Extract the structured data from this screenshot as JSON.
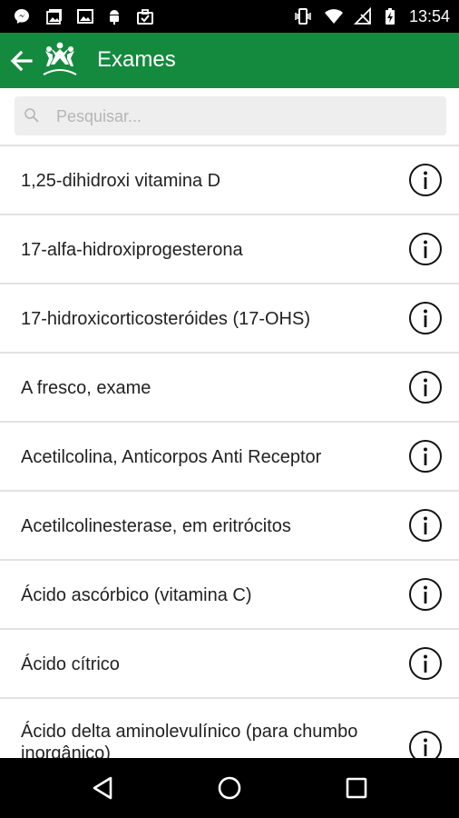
{
  "status_bar": {
    "time": "13:54",
    "icons": [
      "messenger-icon",
      "image-gallery-icon",
      "photo-icon",
      "android-icon",
      "briefcase-check-icon",
      "vibrate-icon",
      "wifi-icon",
      "no-signal-icon",
      "battery-charging-icon"
    ]
  },
  "app_bar": {
    "title": "Exames",
    "background": "#148a3e"
  },
  "search": {
    "placeholder": "Pesquisar..."
  },
  "exams": [
    {
      "label": "1,25-dihidroxi vitamina D"
    },
    {
      "label": "17-alfa-hidroxiprogesterona"
    },
    {
      "label": "17-hidroxicorticosteróides (17-OHS)"
    },
    {
      "label": "A fresco, exame"
    },
    {
      "label": "Acetilcolina, Anticorpos Anti Receptor"
    },
    {
      "label": "Acetilcolinesterase, em eritrócitos"
    },
    {
      "label": "Ácido ascórbico (vitamina C)"
    },
    {
      "label": "Ácido cítrico"
    },
    {
      "label": "Ácido delta aminolevulínico (para chumbo inorgânico)"
    }
  ],
  "nav_bar": {
    "buttons": [
      "back-triangle-icon",
      "home-circle-icon",
      "recents-square-icon"
    ]
  }
}
